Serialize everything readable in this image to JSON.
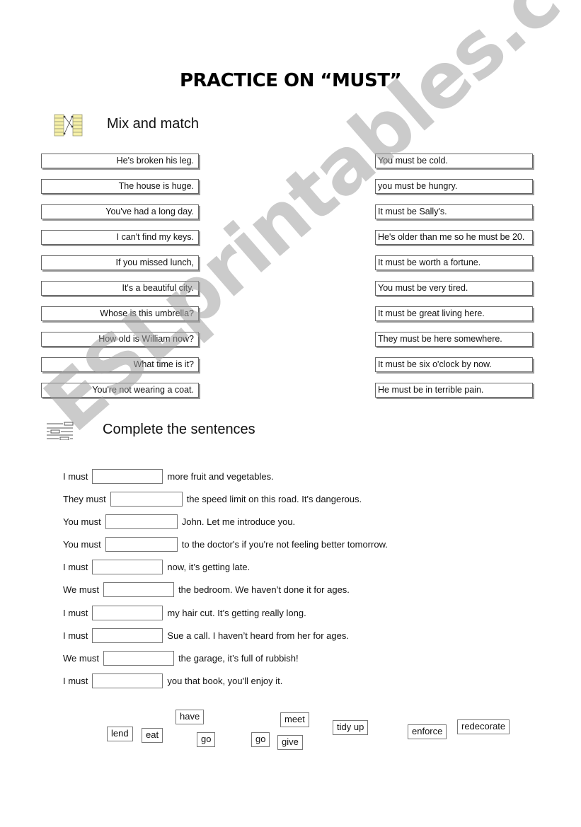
{
  "title": "PRACTICE ON “MUST”",
  "sections": {
    "mix_match": {
      "heading": "Mix and match",
      "icon": "match-lines-icon",
      "left": [
        "He's broken his leg.",
        "The house is huge.",
        "You've had a long day.",
        "I can't find my keys.",
        "If you missed lunch,",
        "It's a beautiful city.",
        "Whose is this umbrella?",
        "How old is William now?",
        "What time is it?",
        "You're not wearing a coat."
      ],
      "right": [
        "You must be cold.",
        "you must be hungry.",
        "It must be Sally's.",
        "He's older than me so he must be 20.",
        "It must be worth a fortune.",
        "You must be very tired.",
        "It must be great living here.",
        "They must be here somewhere.",
        "It must be six o'clock by now.",
        "He must be in terrible pain."
      ]
    },
    "complete": {
      "heading": "Complete the sentences",
      "icon": "gap-fill-icon",
      "sentences": [
        {
          "stem": "I must",
          "rest": "more fruit and vegetables.",
          "value": ""
        },
        {
          "stem": "They must",
          "rest": "the speed limit on this road. It's dangerous.",
          "value": ""
        },
        {
          "stem": "You must",
          "rest": "John. Let me introduce you.",
          "value": ""
        },
        {
          "stem": "You must",
          "rest": "to the doctor's if you're not feeling better tomorrow.",
          "value": ""
        },
        {
          "stem": "I must",
          "rest": "now, it’s getting late.",
          "value": ""
        },
        {
          "stem": "We must",
          "rest": "the bedroom. We haven’t done it for ages.",
          "value": ""
        },
        {
          "stem": "I must",
          "rest": "my hair cut. It’s getting really long.",
          "value": ""
        },
        {
          "stem": "I must",
          "rest": "Sue a call. I haven’t heard from her for ages.",
          "value": ""
        },
        {
          "stem": "We must",
          "rest": "the garage, it’s full of rubbish!",
          "value": ""
        },
        {
          "stem": "I must",
          "rest": "you that book, you'll enjoy it.",
          "value": ""
        }
      ],
      "word_bank": [
        "lend",
        "eat",
        "have",
        "go",
        "go",
        "meet",
        "give",
        "tidy up",
        "enforce",
        "redecorate"
      ]
    }
  },
  "watermark": "ESLprintables.com",
  "colors": {
    "watermark": "#a0a0a0",
    "icon_fill": "#f6f0a8",
    "box_border": "#666666"
  }
}
